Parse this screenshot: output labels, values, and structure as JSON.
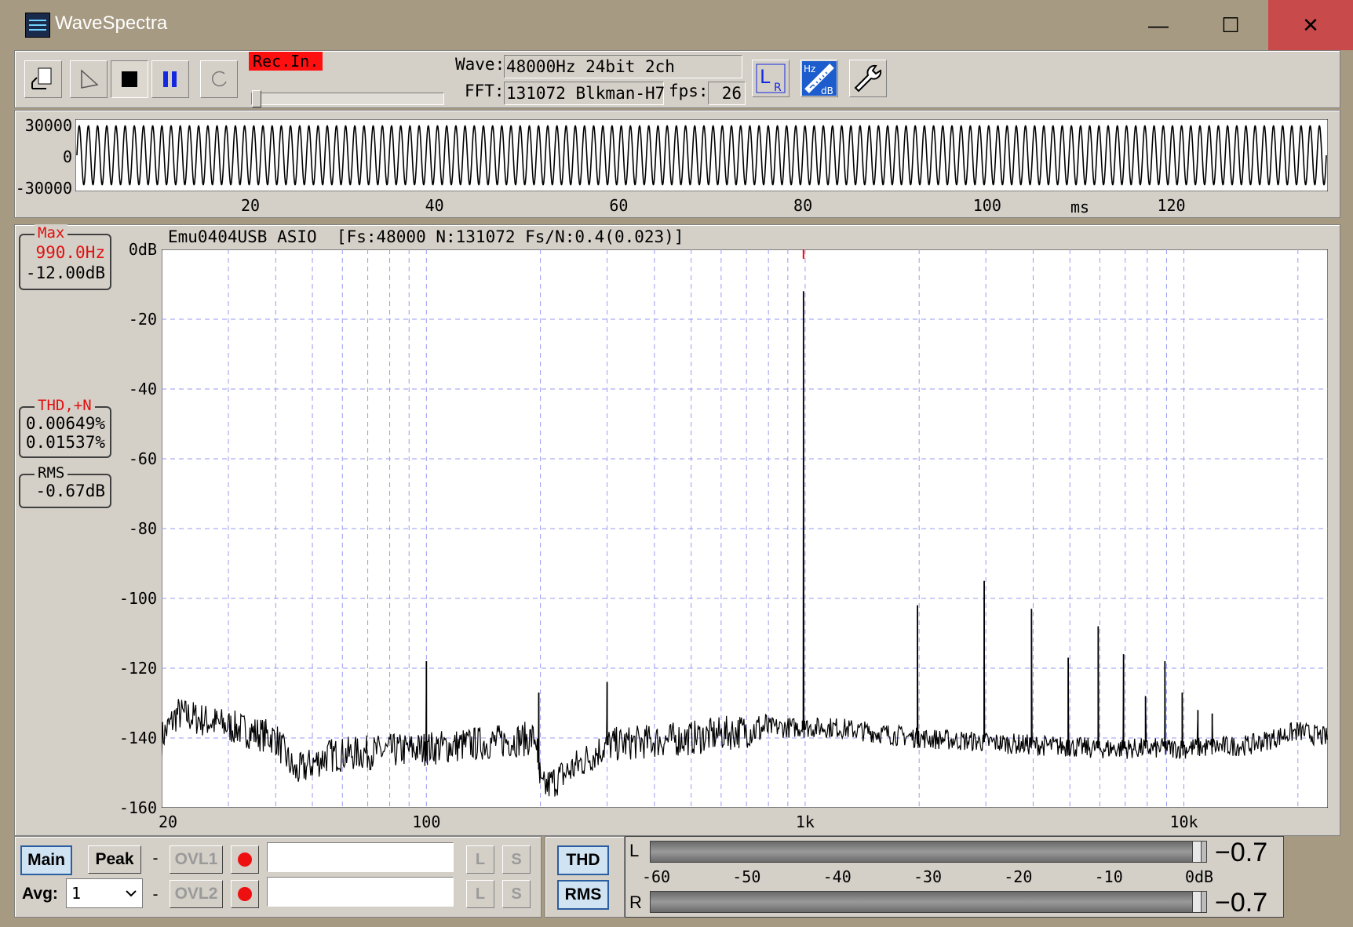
{
  "window": {
    "title": "WaveSpectra",
    "min_glyph": "—",
    "max_glyph": "☐",
    "close_glyph": "✕"
  },
  "toolbar": {
    "rec_label": "Rec.In.",
    "wave_label": "Wave:",
    "wave_value": "48000Hz 24bit 2ch",
    "fft_label": "FFT:",
    "fft_value": "131072 Blkman-H7",
    "fps_label": "fps:",
    "fps_value": "26",
    "lr_label_l": "L",
    "lr_label_r": "R",
    "hz_label": "Hz",
    "db_label": "dB"
  },
  "waveform": {
    "y_ticks": [
      "30000",
      "0",
      "-30000"
    ],
    "x_ticks": [
      "20",
      "40",
      "60",
      "80",
      "100",
      "120"
    ],
    "x_tick_values": [
      20,
      40,
      60,
      80,
      100,
      120
    ],
    "x_range": [
      1,
      137
    ],
    "unit": "ms"
  },
  "spectrum": {
    "header": "Emu0404USB ASIO  [Fs:48000 N:131072 Fs/N:0.4(0.023)]",
    "y_ticks": [
      "0dB",
      "-20",
      "-40",
      "-60",
      "-80",
      "-100",
      "-120",
      "-140",
      "-160"
    ],
    "x_ticks": [
      "20",
      "100",
      "1k",
      "10k"
    ],
    "max": {
      "label": "Max",
      "freq": "990.0Hz",
      "level": "-12.00dB"
    },
    "thd": {
      "label": "THD,+N",
      "thd": "0.00649%",
      "thdn": "0.01537%"
    },
    "rms": {
      "label": "RMS",
      "value": "-0.67dB"
    },
    "colors": {
      "grid": "#9a9af0",
      "trace": "#000000",
      "marker": "#ff0000"
    }
  },
  "chart_data": {
    "type": "line",
    "title": "Emu0404USB ASIO  [Fs:48000 N:131072 Fs/N:0.4(0.023)]",
    "xlabel": "",
    "ylabel": "",
    "x_scale": "log",
    "xlim": [
      20,
      24000
    ],
    "ylim": [
      -160,
      0
    ],
    "grid": true,
    "x_ticks": [
      20,
      100,
      1000,
      10000
    ],
    "y_ticks": [
      0,
      -20,
      -40,
      -60,
      -80,
      -100,
      -120,
      -140,
      -160
    ],
    "noise_floor_points": [
      [
        20,
        -140
      ],
      [
        22,
        -133
      ],
      [
        40,
        -140
      ],
      [
        45,
        -150
      ],
      [
        55,
        -145
      ],
      [
        100,
        -143
      ],
      [
        195,
        -140
      ],
      [
        200,
        -155
      ],
      [
        300,
        -142
      ],
      [
        500,
        -140
      ],
      [
        800,
        -137
      ],
      [
        1200,
        -137
      ],
      [
        2000,
        -140
      ],
      [
        4000,
        -142
      ],
      [
        6000,
        -143
      ],
      [
        10000,
        -143
      ],
      [
        15000,
        -142
      ],
      [
        20000,
        -138
      ],
      [
        24000,
        -140
      ]
    ],
    "peaks": [
      {
        "freq": 990,
        "level": -12
      },
      {
        "freq": 100,
        "level": -118
      },
      {
        "freq": 198,
        "level": -127
      },
      {
        "freq": 300,
        "level": -124
      },
      {
        "freq": 1980,
        "level": -102
      },
      {
        "freq": 2970,
        "level": -95
      },
      {
        "freq": 3960,
        "level": -103
      },
      {
        "freq": 4950,
        "level": -117
      },
      {
        "freq": 5940,
        "level": -108
      },
      {
        "freq": 6930,
        "level": -116
      },
      {
        "freq": 7920,
        "level": -128
      },
      {
        "freq": 8910,
        "level": -118
      },
      {
        "freq": 9900,
        "level": -127
      },
      {
        "freq": 10890,
        "level": -132
      },
      {
        "freq": 11880,
        "level": -133
      }
    ]
  },
  "bottom": {
    "main_label": "Main",
    "peak_label": "Peak",
    "dash": "-",
    "ovl1_label": "OVL1",
    "ovl2_label": "OVL2",
    "l_label": "L",
    "s_label": "S",
    "avg_label": "Avg:",
    "avg_value": "1",
    "thd_label": "THD",
    "rms_label": "RMS"
  },
  "meter": {
    "l_label": "L",
    "r_label": "R",
    "l_value": "−0.7",
    "r_value": "−0.7",
    "scale": [
      "-60",
      "-50",
      "-40",
      "-30",
      "-20",
      "-10",
      "0dB"
    ],
    "l_level_db": -0.7,
    "r_level_db": -0.7
  }
}
